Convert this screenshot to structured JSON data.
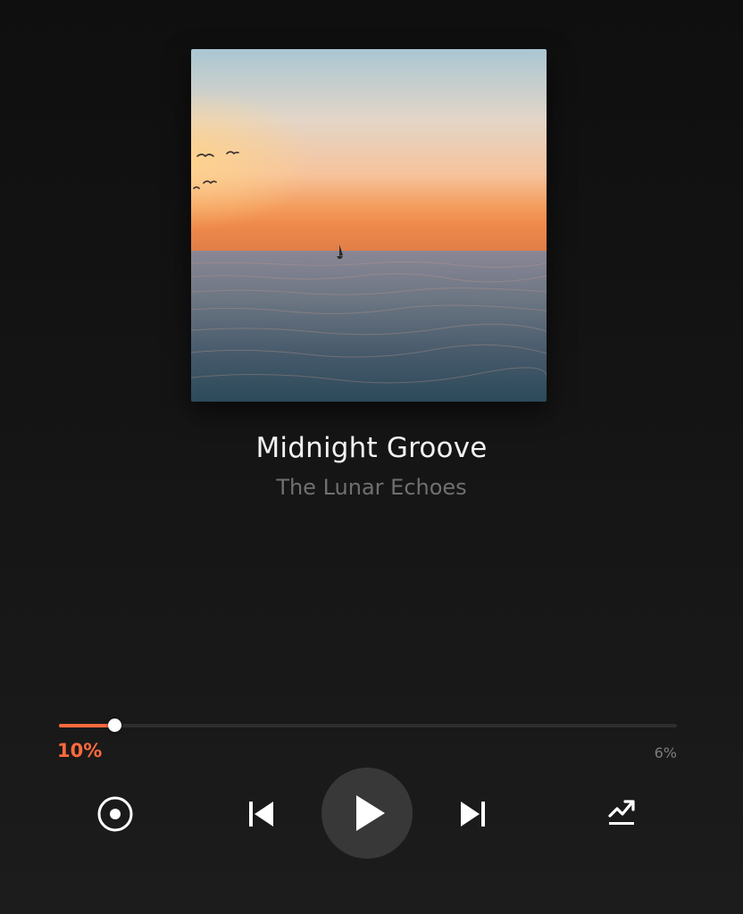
{
  "track": {
    "title": "Midnight Groove",
    "artist": "The Lunar Echoes"
  },
  "album_art": {
    "description_icon": "sunset-sea-sailboat-artwork"
  },
  "playback": {
    "elapsed_label": "10%",
    "total_label": "6%",
    "progress_fraction": 0.09,
    "is_playing": false
  },
  "controls": {
    "left_icon": "radio-target-icon",
    "previous_icon": "skip-previous-icon",
    "play_icon": "play-icon",
    "next_icon": "skip-next-icon",
    "right_icon": "trending-share-icon"
  },
  "colors": {
    "accent": "#ff6a3d",
    "background": "#141414",
    "play_button_bg": "#383838",
    "title": "#f2f2f2",
    "artist": "#707070"
  }
}
